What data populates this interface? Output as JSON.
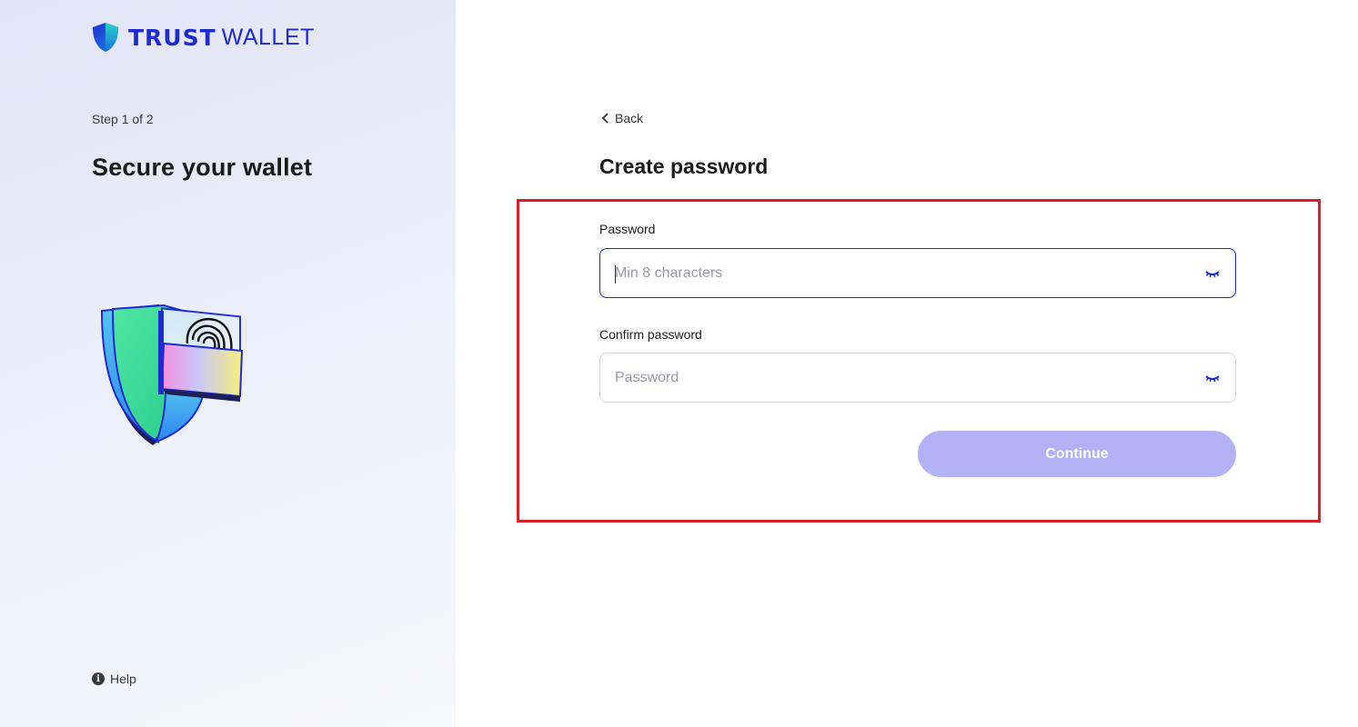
{
  "brand": {
    "name_bold": "TRUST",
    "name_regular": "WALLET",
    "color": "#1d2bd1"
  },
  "left": {
    "step": "Step 1 of 2",
    "title": "Secure your wallet",
    "illustration_icon": "shield-fingerprint-illustration",
    "help_label": "Help",
    "help_icon": "info-icon"
  },
  "right": {
    "back_label": "Back",
    "back_icon": "chevron-left-icon",
    "title": "Create password",
    "password": {
      "label": "Password",
      "placeholder": "Min 8 characters",
      "value": "",
      "toggle_icon": "eye-closed-icon"
    },
    "confirm": {
      "label": "Confirm password",
      "placeholder": "Password",
      "value": "",
      "toggle_icon": "eye-closed-icon"
    },
    "continue_label": "Continue",
    "continue_enabled": false
  },
  "colors": {
    "accent": "#1a2bc7",
    "button_disabled": "#b4b1f6",
    "highlight": "#d9202a"
  }
}
